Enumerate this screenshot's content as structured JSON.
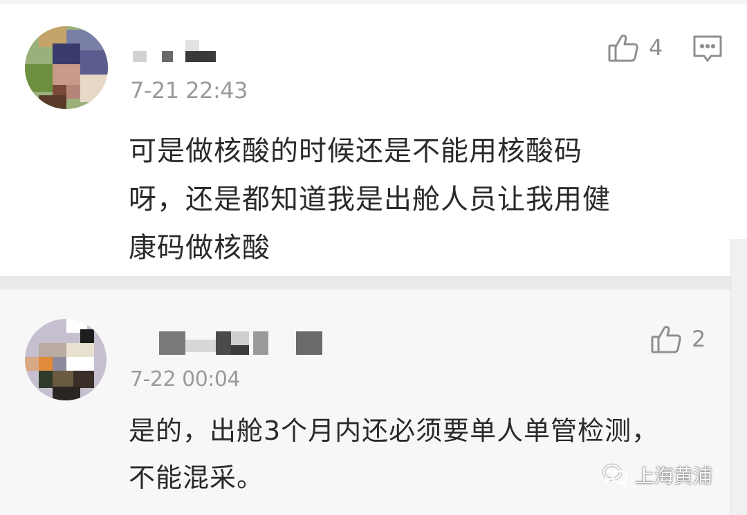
{
  "comments": [
    {
      "username_obscured": "",
      "timestamp": "7-21 22:43",
      "likes": "4",
      "content": "可是做核酸的时候还是不能用核酸码\n呀，还是都知道我是出舱人员让我用健\n康码做核酸",
      "icons": {
        "like": "thumbs-up-icon",
        "reply": "comment-bubble-icon"
      }
    },
    {
      "username_obscured": "",
      "timestamp": "7-22 00:04",
      "likes": "2",
      "content": "是的，出舱3个月内还必须要单人单管检测，\n不能混采。",
      "icons": {
        "like": "thumbs-up-icon"
      }
    }
  ],
  "watermark": {
    "icon": "wechat-icon",
    "text": "上海黄浦"
  },
  "colors": {
    "text_primary": "#2a2a2a",
    "text_secondary": "#9a9a9a",
    "icon": "#8f8f8f",
    "reply_background": "#f7f7f7"
  }
}
